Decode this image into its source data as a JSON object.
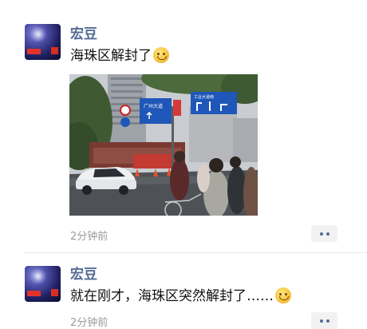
{
  "posts": [
    {
      "author": "宏豆",
      "text": "海珠区解封了",
      "emoji": "grinning-sweat-emoji",
      "time": "2分钟前",
      "has_photo": true
    },
    {
      "author": "宏豆",
      "text": "就在刚才，海珠区突然解封了……",
      "emoji": "grinning-emoji",
      "time": "2分钟前",
      "has_photo": false
    }
  ],
  "photo": {
    "sign_left": "禁止",
    "sign_blue_top": "广州大道",
    "sign_right_top": "工业大道南"
  },
  "colors": {
    "name_link": "#576b95",
    "time_gray": "#9b9b9b",
    "divider": "#e8e8e8"
  }
}
